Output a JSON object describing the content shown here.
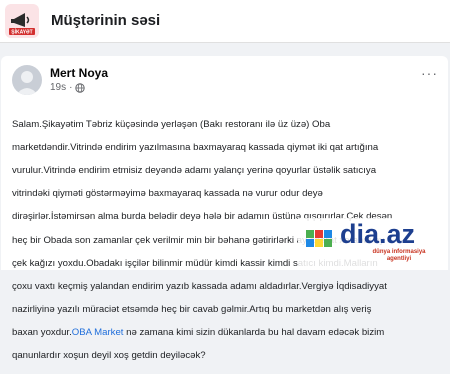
{
  "group": {
    "title": "Müştərinin səsi",
    "logo_icon": "megaphone-icon",
    "logo_badge": "ŞİKAYƏT"
  },
  "post": {
    "author": "Mert Noya",
    "time": "19s",
    "privacy_icon": "globe-icon",
    "more_label": "···",
    "lines": [
      "Salam.Şikayətim Təbriz küçəsində yerləşən (Bakı restoranı ilə üz üzə) Oba",
      "marketdəndir.Vitrində endirim yazılmasına baxmayaraq kassada qiymət iki qat artığına",
      "vurulur.Vitrində endirim etmisiz deyəndə adamı yalançı yerinə qoyurlar üstəlik satıcıya",
      "vitrindəki qiyməti göstərməyimə baxmayaraq kassada nə vurur odur deyə",
      "dirəşirlər.İstəmirsən alma burda belədir deyə hələ bir adamın üstünə qışqırırlar.Çek desən",
      "heç bir Obada son zamanlar çek verilmir min bir bəhanə gətirirlərki ay aparat xarabdı ay",
      "çek kağızı yoxdu.Obadakı işçilər bilinmir müdür kimdi kassir kimdi satıcı kimdi.Malların",
      "çoxu vaxtı keçmiş yalandan endirim yazıb kassada adamı aldadırlar.Vergiyə İqdisadiyyat",
      "nazirliyinə yazılı müraciət etsəmdə heç bir cavab gəlmir.Artıq bu marketdən alış veriş",
      "baxan yoxdur."
    ],
    "link_text": "OBA Market",
    "after_link": " nə zamana kimi sizin dükanlarda bu hal davam edəcək bizim",
    "last_line": "qanunlardır xoşun deyil xoş getdin deyiləcək?"
  },
  "watermark": {
    "logo_text": "dia.az",
    "tagline": "dünya informasiya agentliyi"
  }
}
